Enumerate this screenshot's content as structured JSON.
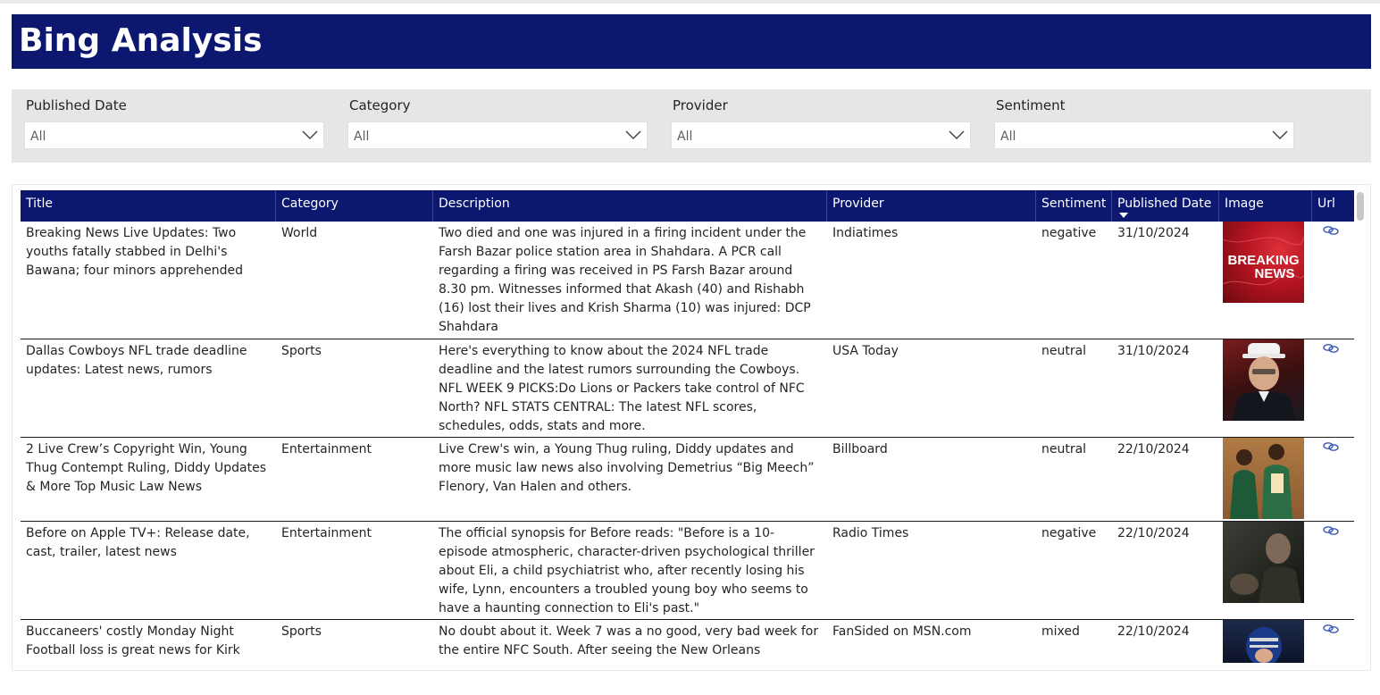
{
  "header": {
    "title": "Bing Analysis"
  },
  "filters": [
    {
      "label": "Published Date",
      "value": "All"
    },
    {
      "label": "Category",
      "value": "All"
    },
    {
      "label": "Provider",
      "value": "All"
    },
    {
      "label": "Sentiment",
      "value": "All"
    }
  ],
  "table": {
    "columns": [
      "Title",
      "Category",
      "Description",
      "Provider",
      "Sentiment",
      "Published Date",
      "Image",
      "Url"
    ],
    "sorted_column": "Published Date",
    "sort_direction": "descending",
    "rows": [
      {
        "title": "Breaking News Live Updates: Two youths fatally stabbed in Delhi's Bawana; four minors apprehended",
        "category": "World",
        "description": "Two died and one was injured in a firing incident under the Farsh Bazar police station area in Shahdara. A PCR call regarding a firing was received in PS Farsh Bazar around 8.30 pm. Witnesses informed that Akash (40) and Rishabh (16) lost their lives and Krish Sharma (10) was injured: DCP Shahdara",
        "provider": "Indiatimes",
        "sentiment": "negative",
        "published": "31/10/2024",
        "image": {
          "line1": "BREAKING",
          "line2": "NEWS"
        },
        "url_icon": "link-icon"
      },
      {
        "title": "Dallas Cowboys NFL trade deadline updates: Latest news, rumors",
        "category": "Sports",
        "description": "Here's everything to know about the 2024 NFL trade deadline and the latest rumors surrounding the Cowboys. NFL WEEK 9 PICKS:Do Lions or Packers take control of NFC North? NFL STATS CENTRAL: The latest NFL scores, schedules, odds, stats and more.",
        "provider": "USA Today",
        "sentiment": "neutral",
        "published": "31/10/2024",
        "url_icon": "link-icon"
      },
      {
        "title": "2 Live Crew’s Copyright Win, Young Thug Contempt Ruling, Diddy Updates & More Top Music Law News",
        "category": "Entertainment",
        "description": "Live Crew's win, a Young Thug ruling, Diddy updates and more music law news also involving Demetrius “Big Meech” Flenory, Van Halen and others.",
        "provider": "Billboard",
        "sentiment": "neutral",
        "published": "22/10/2024",
        "url_icon": "link-icon"
      },
      {
        "title": "Before on Apple TV+: Release date, cast, trailer, latest news",
        "category": "Entertainment",
        "description": "The official synopsis for Before reads: \"Before is a 10-episode atmospheric, character-driven psychological thriller about Eli, a child psychiatrist who, after recently losing his wife, Lynn, encounters a troubled young boy who seems to have a haunting connection to Eli's past.\"",
        "provider": "Radio Times",
        "sentiment": "negative",
        "published": "22/10/2024",
        "url_icon": "link-icon"
      },
      {
        "title": "Buccaneers' costly Monday Night Football loss is great news for Kirk",
        "category": "Sports",
        "description": "No doubt about it. Week 7 was a no good, very bad week for the entire NFC South. After seeing the New Orleans",
        "provider": "FanSided on MSN.com",
        "sentiment": "mixed",
        "published": "22/10/2024",
        "url_icon": "link-icon"
      }
    ]
  },
  "colors": {
    "header_bg": "#0c1870",
    "filter_panel_bg": "#e6e6e6",
    "link_icon": "#3b5bb5"
  }
}
